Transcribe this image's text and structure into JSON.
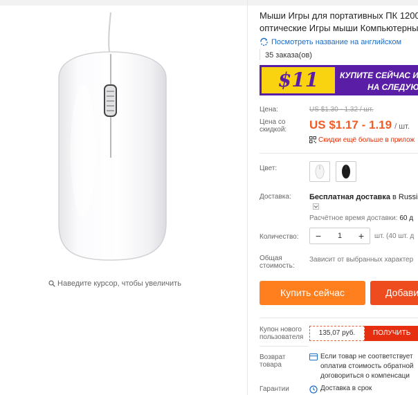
{
  "product": {
    "title_line1": "Мыши Игры для портативных ПК 1200",
    "title_line2": "оптические Игры мыши Компьютерны",
    "translate_link": "Посмотреть название на английском",
    "orders": "35 заказа(ов)",
    "zoom_hint": "Наведите курсор, чтобы увеличить"
  },
  "banner": {
    "price": "$11",
    "line1": "КУПИТЕ СЕЙЧАС И",
    "line2": "НА СЛЕДУЮ"
  },
  "pricing": {
    "price_label": "Цена:",
    "old_price": "US $1.30 - 1.32 / шт.",
    "discount_label_1": "Цена со",
    "discount_label_2": "скидкой:",
    "price": "US $1.17 - 1.19",
    "unit": "/ шт.",
    "app_discount": "Скидки ещё больше в прилож"
  },
  "color": {
    "label": "Цвет:",
    "options": [
      "white",
      "black"
    ]
  },
  "shipping": {
    "label": "Доставка:",
    "free_prefix": "Бесплатная доставка",
    "free_suffix": " в Russian",
    "time_label": "Расчётное время доставки:",
    "time_value": " 60 д"
  },
  "quantity": {
    "label": "Количество:",
    "minus": "−",
    "value": "1",
    "plus": "+",
    "note": "шт. (40 шт. д"
  },
  "total": {
    "label_1": "Общая",
    "label_2": "стоимость:",
    "note": "Зависит от выбранных характер"
  },
  "actions": {
    "buy_now": "Купить сейчас",
    "add_to_cart": "Добави"
  },
  "coupon": {
    "label_1": "Купон нового",
    "label_2": "пользователя",
    "value": "135,07 руб.",
    "get_button": "ПОЛУЧИТЬ"
  },
  "returns": {
    "label_1": "Возврат",
    "label_2": "товара",
    "line1": "Если товар не соответствует",
    "line2": "оплатив стоимость обратной",
    "line3": "договориться о компенсаци"
  },
  "guarantee": {
    "label": "Гарантии",
    "text": "Доставка в срок"
  },
  "colors": {
    "accent_orange": "#f25c23",
    "buy_button": "#ff7f1e",
    "cart_button": "#ee4b1f",
    "banner_bg": "#5a1ea6",
    "banner_price_bg": "#f9d210",
    "link_blue": "#1a6cc7"
  }
}
